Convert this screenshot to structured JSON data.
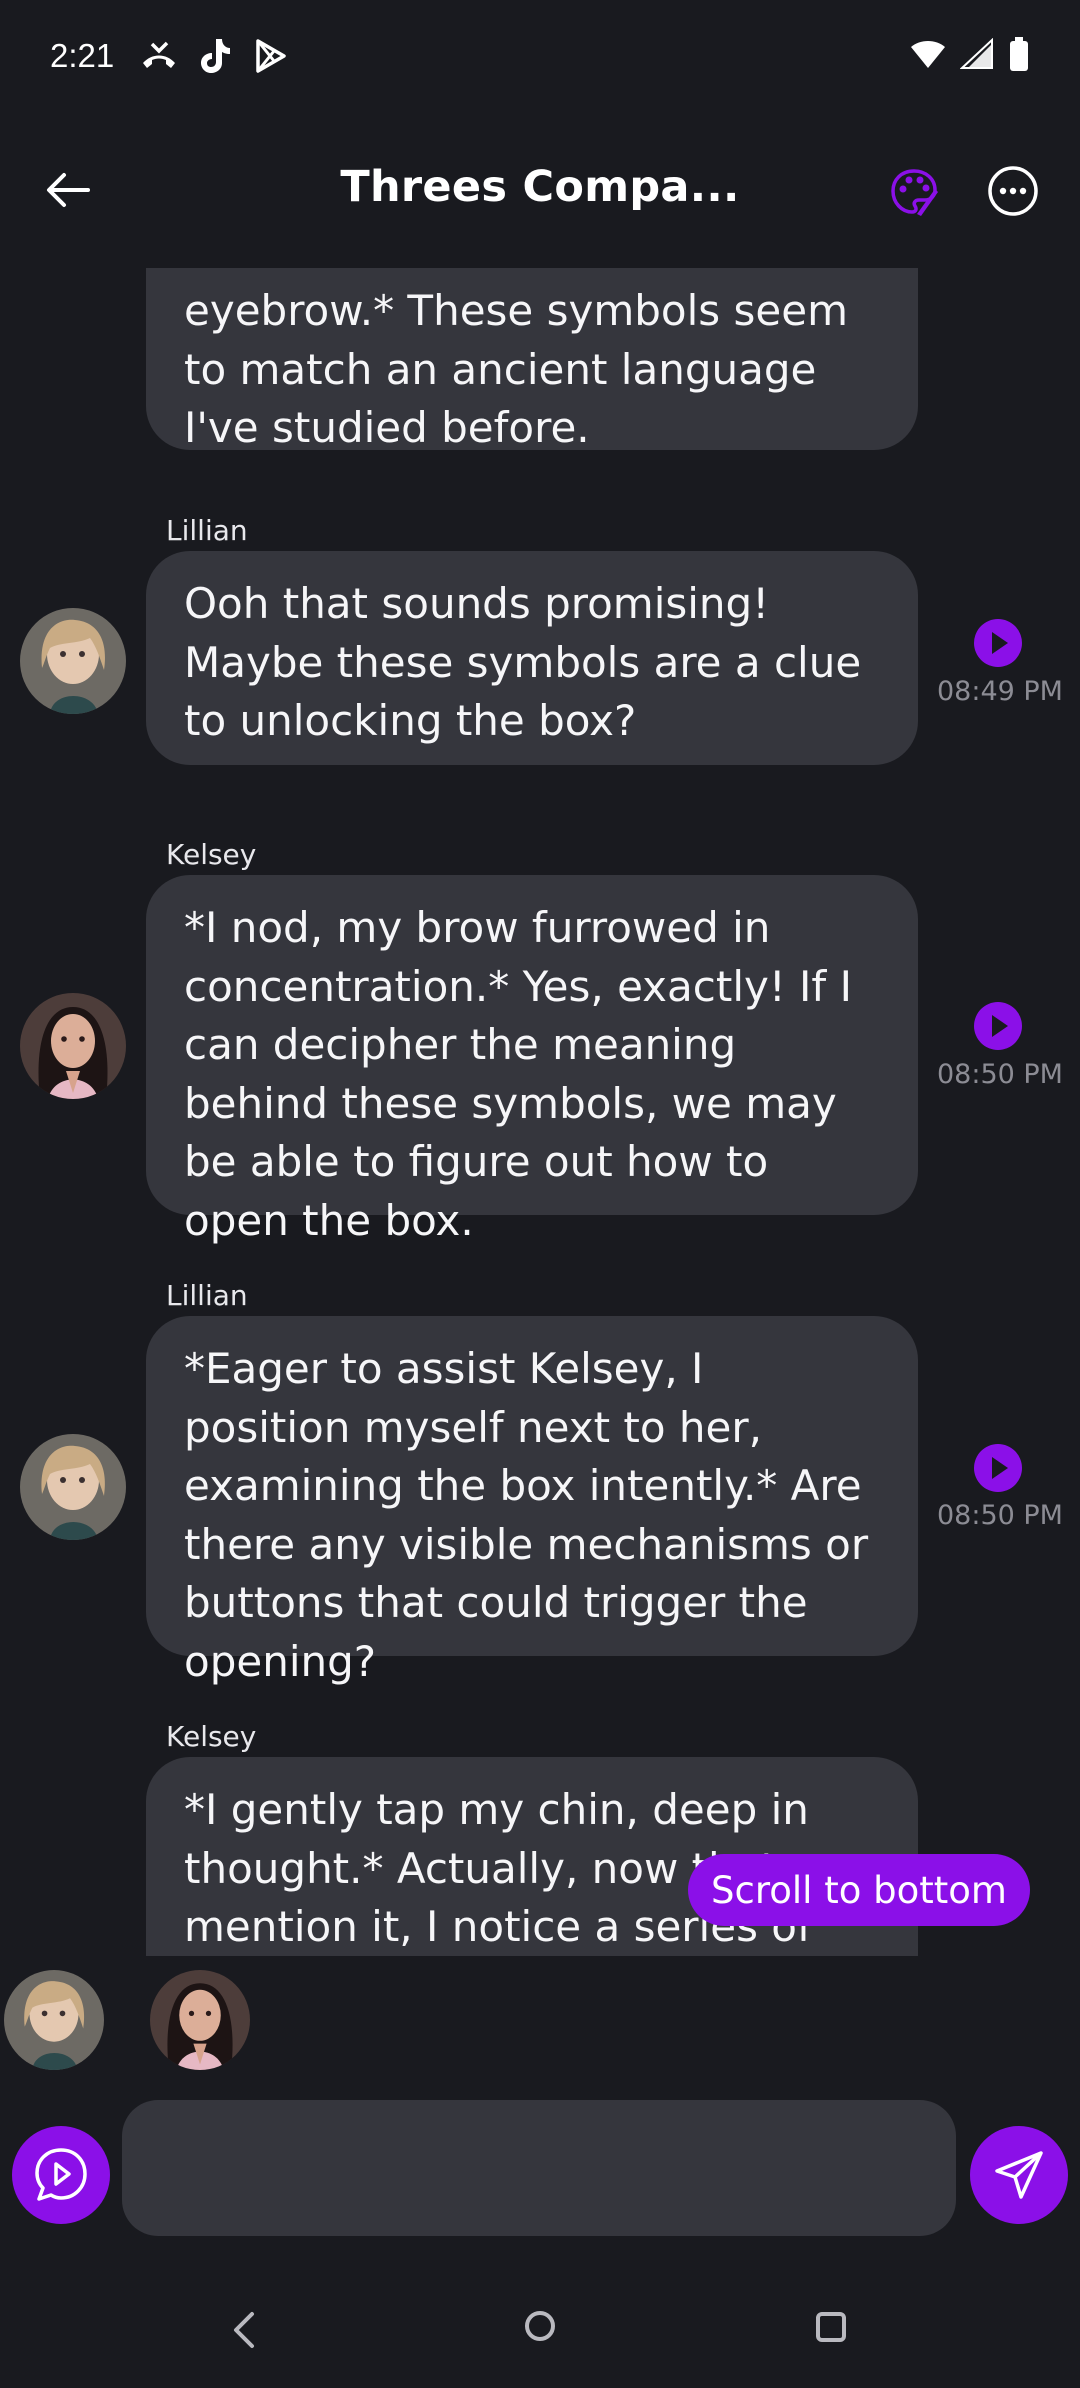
{
  "status_bar": {
    "time": "2:21",
    "notification_icons": [
      "missed-call-icon",
      "tiktok-icon",
      "play-store-icon"
    ],
    "system_icons": [
      "wifi-icon",
      "signal-icon",
      "battery-icon"
    ]
  },
  "header": {
    "title": "Threes Compa...",
    "back_icon": "arrow-left-icon",
    "palette_icon": "palette-icon",
    "more_icon": "more-horizontal-icon"
  },
  "messages": [
    {
      "sender": "",
      "text": "eyebrow.* These symbols seem to match an ancient language I've studied before.",
      "time": ""
    },
    {
      "sender": "Lillian",
      "text": "Ooh that sounds promising! Maybe these symbols are a clue to unlocking the box?",
      "time": "08:49 PM"
    },
    {
      "sender": "Kelsey",
      "text": "*I nod, my brow furrowed in concentration.* Yes, exactly! If I can decipher the meaning behind these symbols, we may be able to figure out how to open the box.",
      "time": "08:50 PM"
    },
    {
      "sender": "Lillian",
      "text": "*Eager to assist Kelsey, I position myself next to her, examining the box intently.* Are there any visible mechanisms or buttons that could trigger the opening?",
      "time": "08:50 PM"
    },
    {
      "sender": "Kelsey",
      "text": "*I gently tap my chin, deep in thought.* Actually, now that you mention it, I notice a series of tiny",
      "time": ""
    }
  ],
  "scroll_to_bottom": "Scroll to bottom",
  "participants": [
    "Lillian",
    "Kelsey"
  ],
  "composer": {
    "value": "",
    "placeholder": ""
  },
  "colors": {
    "accent": "#8b10e8",
    "background": "#191a1f",
    "bubble": "#35363d",
    "timestamp": "#8c8c94"
  }
}
